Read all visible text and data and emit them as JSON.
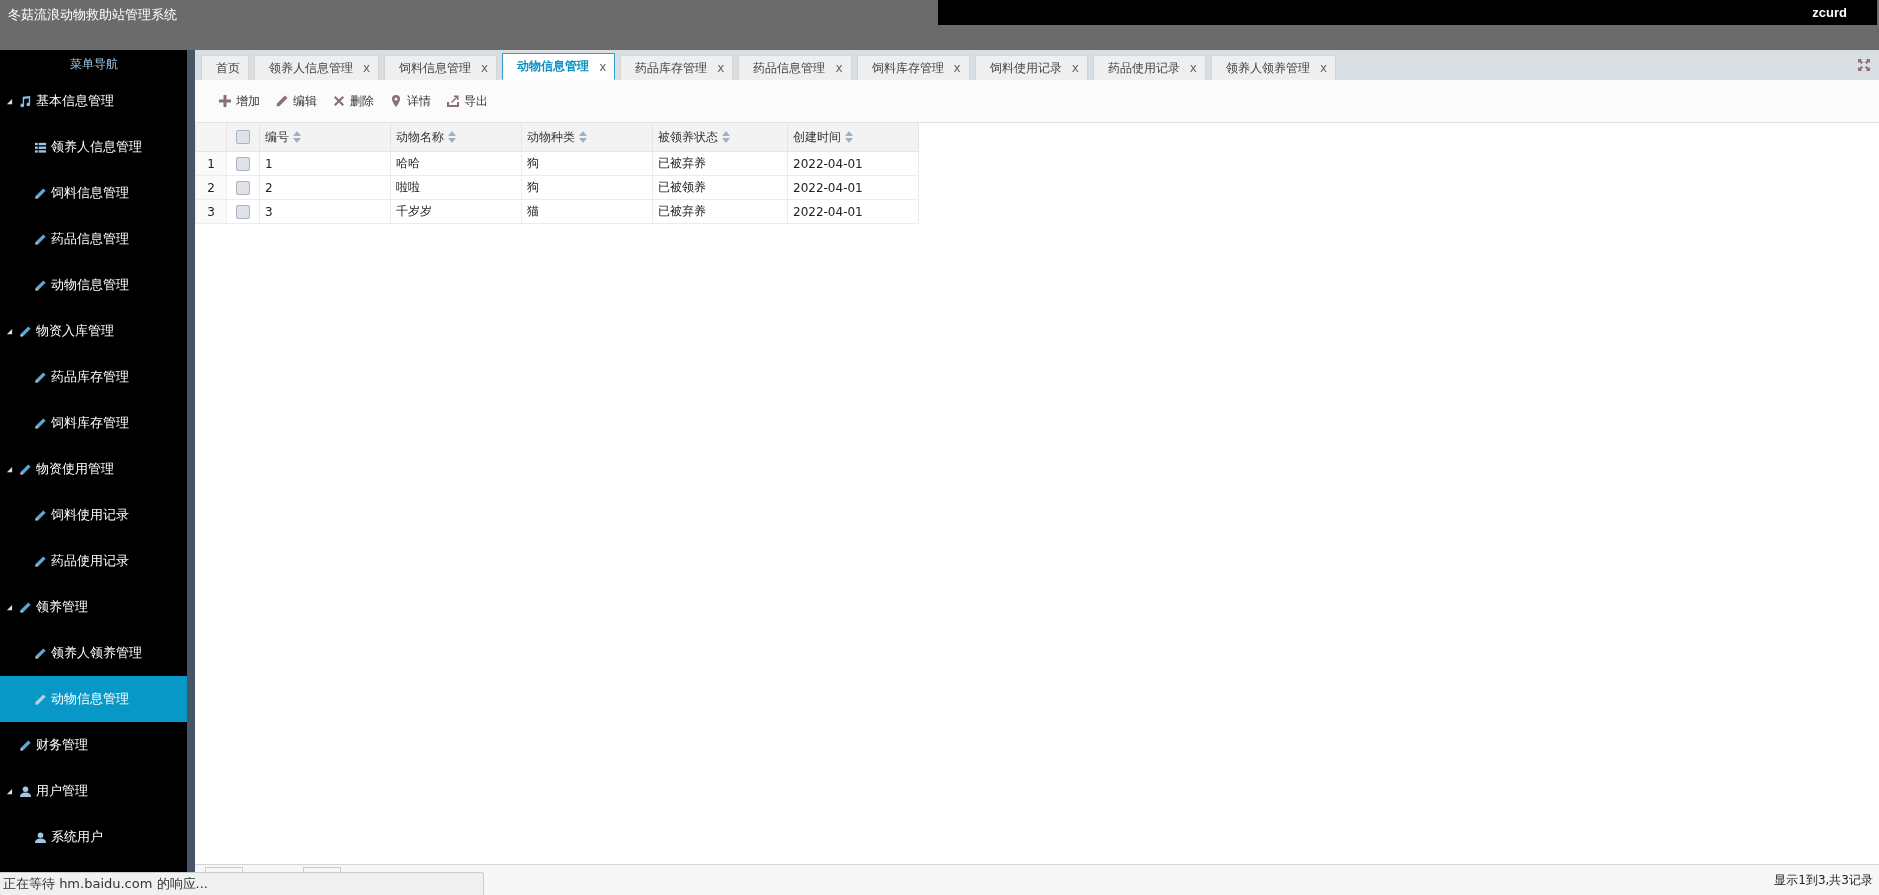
{
  "header": {
    "title": "冬菇流浪动物救助站管理系统",
    "user": "zcurd"
  },
  "sidebar": {
    "title": "菜单导航",
    "items": [
      {
        "label": "基本信息管理",
        "expanded": true,
        "selected": false,
        "children": [
          {
            "label": "领养人信息管理",
            "selected": false
          },
          {
            "label": "饲料信息管理",
            "selected": false
          },
          {
            "label": "药品信息管理",
            "selected": false
          },
          {
            "label": "动物信息管理",
            "selected": false
          }
        ]
      },
      {
        "label": "物资入库管理",
        "expanded": true,
        "selected": false,
        "children": [
          {
            "label": "药品库存管理",
            "selected": false
          },
          {
            "label": "饲料库存管理",
            "selected": false
          }
        ]
      },
      {
        "label": "物资使用管理",
        "expanded": true,
        "selected": false,
        "children": [
          {
            "label": "饲料使用记录",
            "selected": false
          },
          {
            "label": "药品使用记录",
            "selected": false
          }
        ]
      },
      {
        "label": "领养管理",
        "expanded": true,
        "selected": false,
        "children": [
          {
            "label": "领养人领养管理",
            "selected": false
          },
          {
            "label": "动物信息管理",
            "selected": true
          }
        ]
      },
      {
        "label": "财务管理",
        "selected": false
      },
      {
        "label": "用户管理",
        "expanded": true,
        "selected": false,
        "children": [
          {
            "label": "系统用户",
            "selected": false
          }
        ]
      }
    ]
  },
  "tabs": [
    {
      "label": "首页",
      "selected": false
    },
    {
      "label": "领养人信息管理",
      "close": "x",
      "selected": false
    },
    {
      "label": "饲料信息管理",
      "close": "x",
      "selected": false
    },
    {
      "label": "动物信息管理",
      "close": "x",
      "selected": true
    },
    {
      "label": "药品库存管理",
      "close": "x",
      "selected": false
    },
    {
      "label": "药品信息管理",
      "close": "x",
      "selected": false
    },
    {
      "label": "饲料库存管理",
      "close": "x",
      "selected": false
    },
    {
      "label": "饲料使用记录",
      "close": "x",
      "selected": false
    },
    {
      "label": "药品使用记录",
      "close": "x",
      "selected": false
    },
    {
      "label": "领养人领养管理",
      "close": "x",
      "selected": false
    }
  ],
  "toolbar": [
    {
      "label": "增加",
      "kind": "add"
    },
    {
      "label": "编辑",
      "kind": "edit"
    },
    {
      "label": "删除",
      "kind": "delete"
    },
    {
      "label": "详情",
      "kind": "detail"
    },
    {
      "label": "导出",
      "kind": "export"
    }
  ],
  "table": {
    "select_all_checked": false,
    "columns": [
      "编号",
      "动物名称",
      "动物种类",
      "被领养状态",
      "创建时间"
    ],
    "rows": [
      {
        "index": "1",
        "checked": false,
        "cells": [
          "1",
          "哈哈",
          "狗",
          "已被弃养",
          "2022-04-01"
        ]
      },
      {
        "index": "2",
        "checked": false,
        "cells": [
          "2",
          "啦啦",
          "狗",
          "已被领养",
          "2022-04-01"
        ]
      },
      {
        "index": "3",
        "checked": false,
        "cells": [
          "3",
          "千岁岁",
          "猫",
          "已被弃养",
          "2022-04-01"
        ]
      }
    ]
  },
  "pager": {
    "summary": "显示1到3,共3记录"
  },
  "browser_status": "正在等待 hm.baidu.com 的响应..."
}
